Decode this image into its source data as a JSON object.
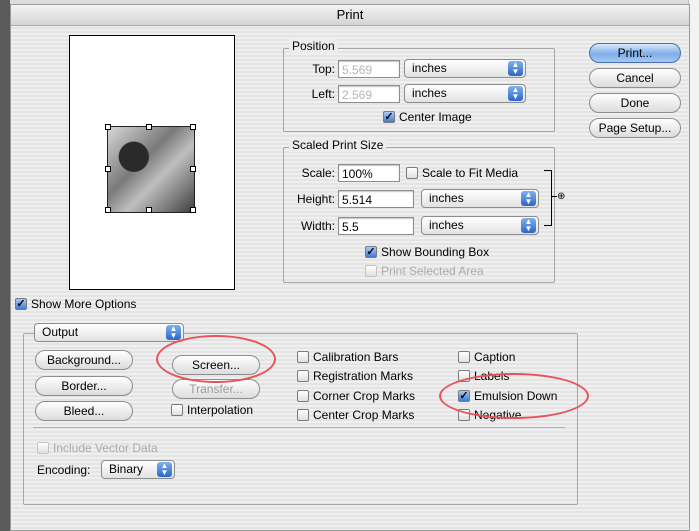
{
  "window": {
    "title": "Print"
  },
  "position": {
    "label": "Position",
    "top_label": "Top:",
    "top_value": "5.569",
    "top_unit": "inches",
    "left_label": "Left:",
    "left_value": "2.569",
    "left_unit": "inches",
    "center_image": "Center Image"
  },
  "scaled": {
    "label": "Scaled Print Size",
    "scale_label": "Scale:",
    "scale_value": "100%",
    "scale_to_fit": "Scale to Fit Media",
    "height_label": "Height:",
    "height_value": "5.514",
    "height_unit": "inches",
    "width_label": "Width:",
    "width_value": "5.5",
    "width_unit": "inches",
    "show_bounding_box": "Show Bounding Box",
    "print_selected_area": "Print Selected Area"
  },
  "buttons": {
    "print": "Print...",
    "cancel": "Cancel",
    "done": "Done",
    "page_setup": "Page Setup..."
  },
  "show_more": "Show More Options",
  "output": {
    "menu": "Output",
    "background": "Background...",
    "border": "Border...",
    "bleed": "Bleed...",
    "screen": "Screen...",
    "transfer": "Transfer...",
    "interpolation": "Interpolation",
    "calibration_bars": "Calibration Bars",
    "registration_marks": "Registration Marks",
    "corner_crop_marks": "Corner Crop Marks",
    "center_crop_marks": "Center Crop Marks",
    "caption": "Caption",
    "labels": "Labels",
    "emulsion_down": "Emulsion Down",
    "negative": "Negative",
    "include_vector": "Include Vector Data",
    "encoding_label": "Encoding:",
    "encoding_value": "Binary"
  },
  "colors": {
    "default_button": "#7eaee9",
    "annotation": "#e8535a"
  }
}
